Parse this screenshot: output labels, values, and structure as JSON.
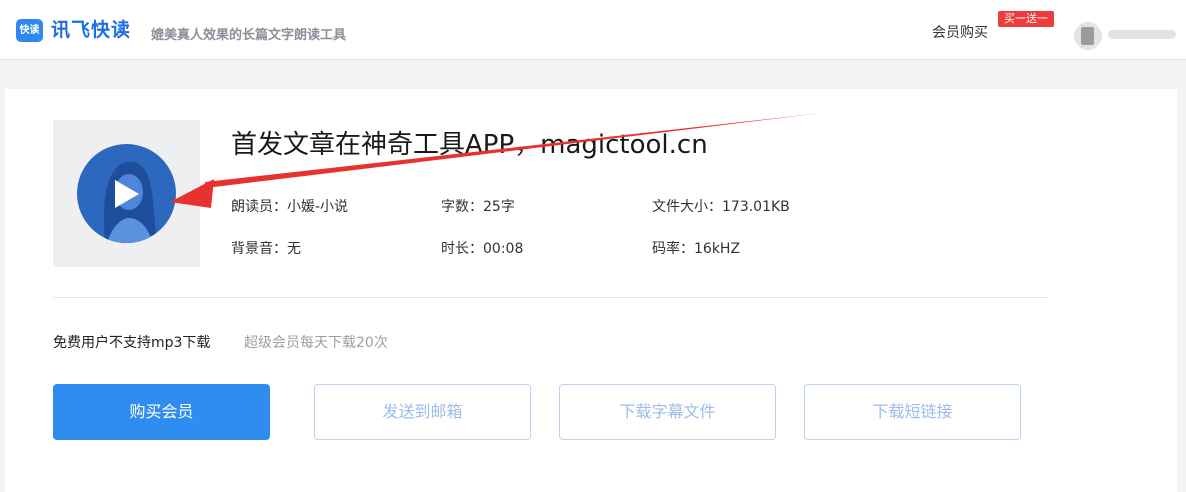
{
  "header": {
    "logo_badge": "快读",
    "brand": "讯飞快读",
    "slogan": "媲美真人效果的长篇文字朗读工具",
    "vip_link": "会员购买",
    "promo_badge": "买一送一"
  },
  "audio": {
    "title": "首发文章在神奇工具APP，magictool.cn",
    "reader": "朗读员：小媛-小说",
    "word_count": "字数：25字",
    "file_size": "文件大小：173.01KB",
    "bgm": "背景音：无",
    "duration": "时长：00:08",
    "bitrate": "码率：16kHZ"
  },
  "notice": {
    "main": "免费用户不支持mp3下载",
    "sub": "超级会员每天下载20次"
  },
  "buttons": {
    "buy_vip": "购买会员",
    "send_email": "发送到邮箱",
    "download_subtitle": "下载字幕文件",
    "download_short_link": "下载短链接"
  },
  "colors": {
    "brand_blue": "#2f8df0",
    "annotation_red": "#e8322f"
  }
}
